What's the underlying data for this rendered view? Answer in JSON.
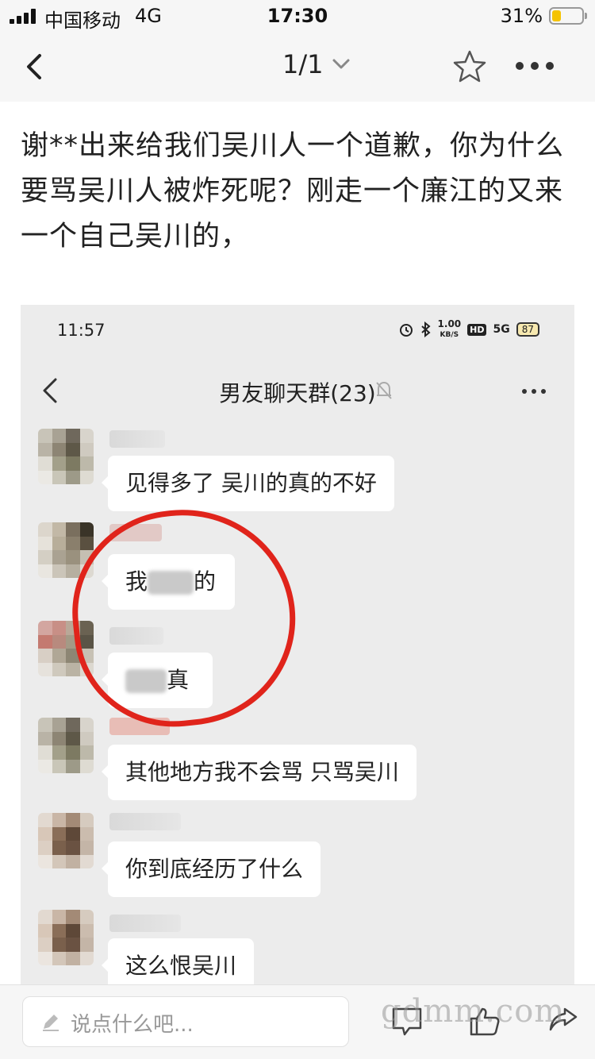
{
  "status_bar": {
    "carrier": "中国移动",
    "network": "4G",
    "time": "17:30",
    "battery_percent": "31%",
    "battery_level": 0.31,
    "battery_color": "#f5c300"
  },
  "nav": {
    "back_icon": "chevron-left-icon",
    "pager": "1/1",
    "pager_icon": "chevron-down-icon",
    "favorite_icon": "star-icon",
    "more_icon": "more-dots-icon"
  },
  "post": {
    "text": "谢**出来给我们吴川人一个道歉，你为什么要骂吴川人被炸死呢？刚走一个廉江的又来一个自己吴川的，"
  },
  "screenshot": {
    "status": {
      "time": "11:57",
      "net_speed_top": "1.00",
      "net_speed_bottom": "KB/S",
      "hd": "HD",
      "signal": "5G",
      "battery": "87"
    },
    "chat_title": "男友聊天群(23)",
    "messages": [
      {
        "text": "见得多了 吴川的真的不好"
      },
      {
        "prefix": "我",
        "suffix": "的"
      },
      {
        "prefix": "",
        "suffix": "真"
      },
      {
        "text": "其他地方我不会骂  只骂吴川"
      },
      {
        "text": "你到底经历了什么"
      },
      {
        "text": "这么恨吴川"
      }
    ],
    "highlight_color": "#e0241b"
  },
  "bottom_bar": {
    "comment_placeholder": "说点什么吧...",
    "watermark": "gdmm.com"
  }
}
